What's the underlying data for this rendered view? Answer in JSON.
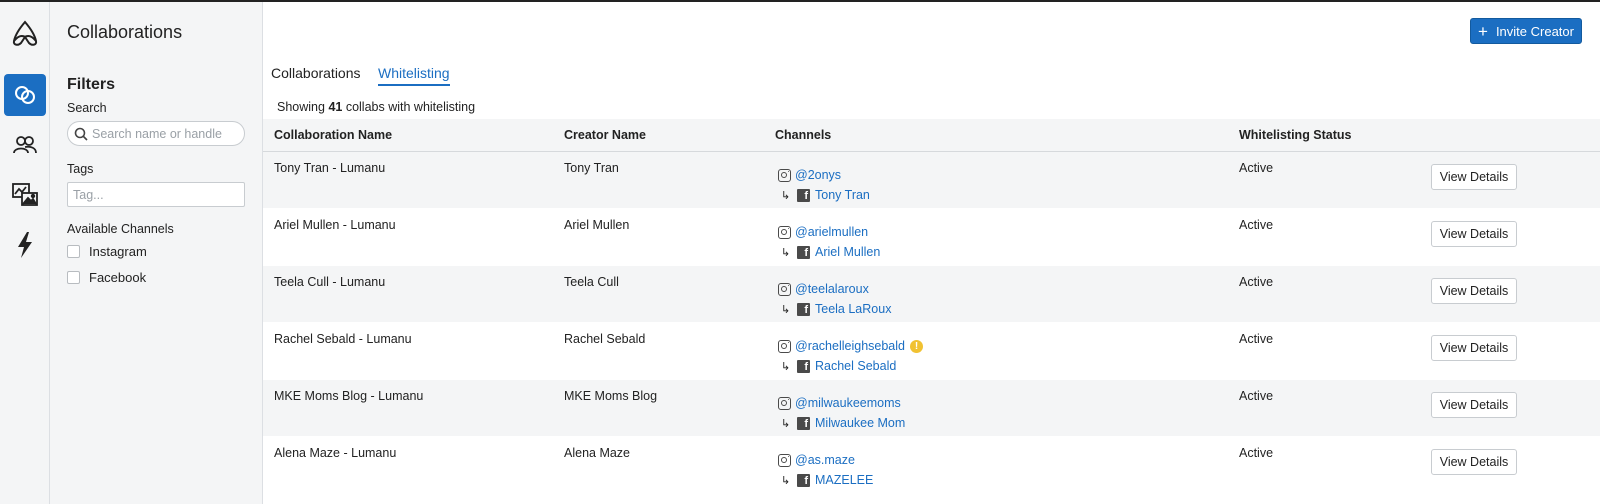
{
  "app": {
    "page_title": "Collaborations"
  },
  "nav": {
    "items": [
      {
        "icon": "collaborations-icon",
        "active": true
      },
      {
        "icon": "people-icon",
        "active": false
      },
      {
        "icon": "media-icon",
        "active": false
      },
      {
        "icon": "lightning-icon",
        "active": false
      }
    ]
  },
  "filters": {
    "heading": "Filters",
    "search_label": "Search",
    "search_placeholder": "Search name or handle",
    "search_value": "",
    "tags_label": "Tags",
    "tags_placeholder": "Tag...",
    "channels_label": "Available Channels",
    "channels": [
      {
        "label": "Instagram",
        "checked": false
      },
      {
        "label": "Facebook",
        "checked": false
      }
    ]
  },
  "header": {
    "invite_label": "Invite Creator"
  },
  "tabs": [
    {
      "label": "Collaborations",
      "active": false
    },
    {
      "label": "Whitelisting",
      "active": true
    }
  ],
  "summary": {
    "prefix": "Showing",
    "count": "41",
    "suffix": "collabs with whitelisting"
  },
  "table": {
    "columns": [
      "Collaboration Name",
      "Creator Name",
      "Channels",
      "Whitelisting Status"
    ],
    "action_label": "View Details",
    "rows": [
      {
        "collab": "Tony Tran - Lumanu",
        "creator": "Tony Tran",
        "instagram": "@2onys",
        "facebook": "Tony Tran",
        "warning": false,
        "status": "Active"
      },
      {
        "collab": "Ariel Mullen - Lumanu",
        "creator": "Ariel Mullen",
        "instagram": "@arielmullen",
        "facebook": "Ariel Mullen",
        "warning": false,
        "status": "Active"
      },
      {
        "collab": "Teela Cull - Lumanu",
        "creator": "Teela Cull",
        "instagram": "@teelalaroux",
        "facebook": "Teela LaRoux",
        "warning": false,
        "status": "Active"
      },
      {
        "collab": "Rachel Sebald - Lumanu",
        "creator": "Rachel Sebald",
        "instagram": "@rachelleighsebald",
        "facebook": "Rachel Sebald",
        "warning": true,
        "status": "Active"
      },
      {
        "collab": "MKE Moms Blog - Lumanu",
        "creator": "MKE Moms Blog",
        "instagram": "@milwaukeemoms",
        "facebook": "Milwaukee Mom",
        "warning": false,
        "status": "Active"
      },
      {
        "collab": "Alena Maze - Lumanu",
        "creator": "Alena Maze",
        "instagram": "@as.maze",
        "facebook": "MAZELEE",
        "warning": false,
        "status": "Active"
      }
    ]
  },
  "colors": {
    "accent": "#1b6ec2",
    "sidebar_bg": "#f4f5f6",
    "warning": "#f1c232"
  }
}
